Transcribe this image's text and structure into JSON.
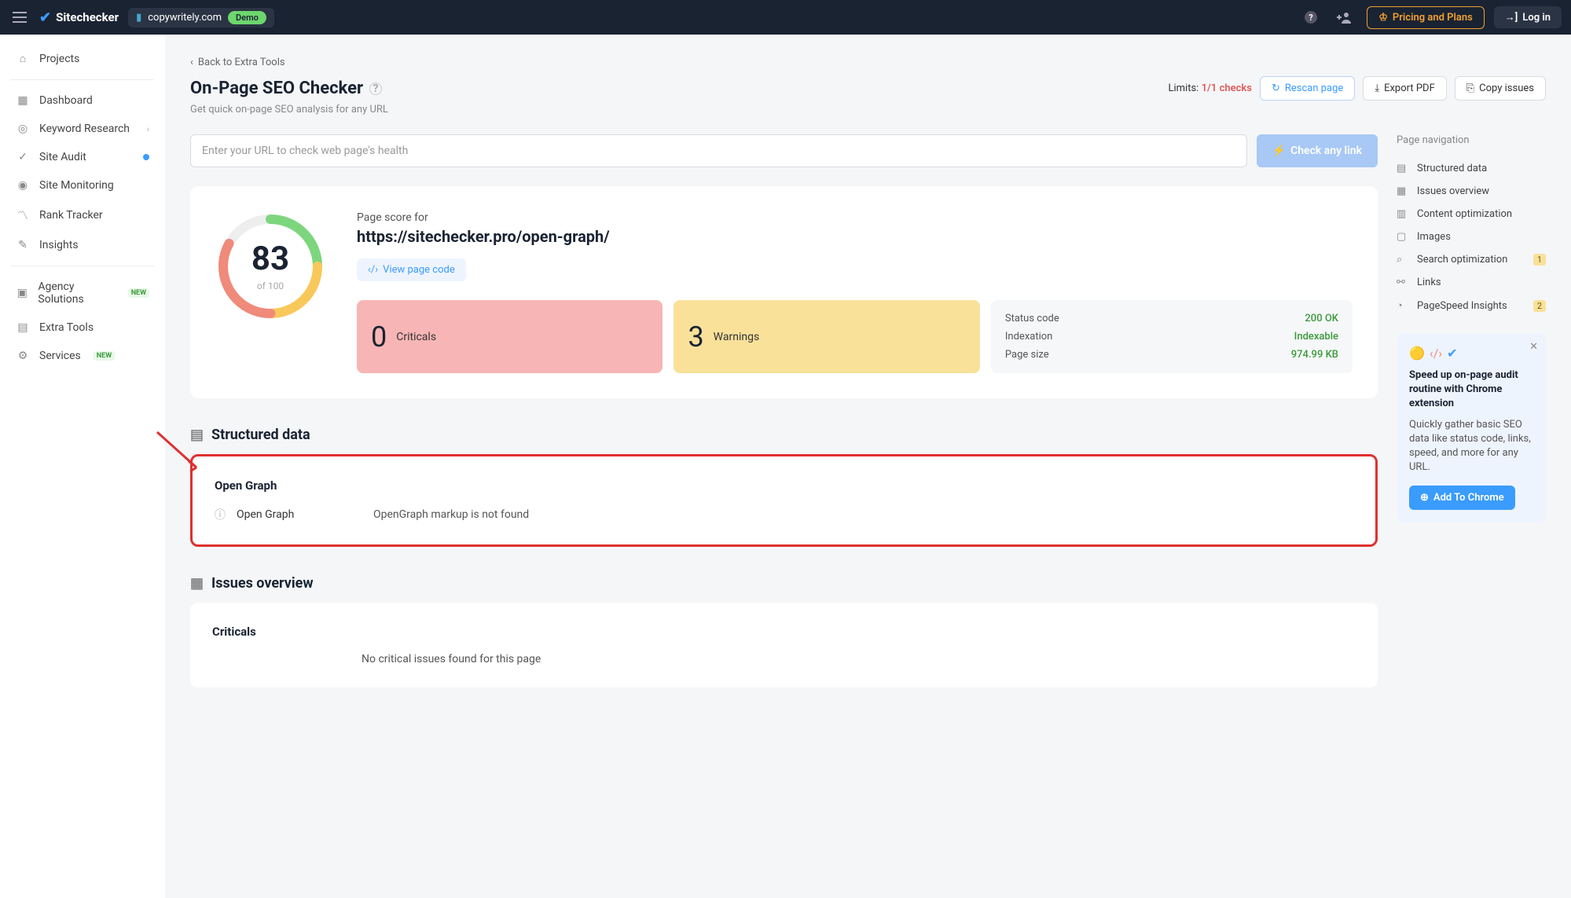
{
  "topbar": {
    "brand": "Sitechecker",
    "site": "copywritely.com",
    "demo": "Demo",
    "pricing": "Pricing and Plans",
    "login": "Log in"
  },
  "sidebar": {
    "projects": "Projects",
    "items": [
      {
        "label": "Dashboard"
      },
      {
        "label": "Keyword Research"
      },
      {
        "label": "Site Audit"
      },
      {
        "label": "Site Monitoring"
      },
      {
        "label": "Rank Tracker"
      },
      {
        "label": "Insights"
      }
    ],
    "agency": "Agency Solutions",
    "extra": "Extra Tools",
    "services": "Services",
    "new": "NEW"
  },
  "breadcrumb": "Back to Extra Tools",
  "page": {
    "title": "On-Page SEO Checker",
    "subtitle": "Get quick on-page SEO analysis for any URL",
    "limits_label": "Limits:",
    "limits_value": "1/1 checks",
    "rescan": "Rescan page",
    "export": "Export PDF",
    "copy": "Copy issues"
  },
  "url": {
    "placeholder": "Enter your URL to check web page's health",
    "check": "Check any link"
  },
  "score": {
    "value": "83",
    "sub": "of 100",
    "for": "Page score for",
    "url": "https://sitechecker.pro/open-graph/",
    "viewcode": "View page code",
    "criticals_n": "0",
    "criticals": "Criticals",
    "warnings_n": "3",
    "warnings": "Warnings",
    "status_label": "Status code",
    "status_val": "200 OK",
    "index_label": "Indexation",
    "index_val": "Indexable",
    "size_label": "Page size",
    "size_val": "974.99 KB"
  },
  "structured": {
    "title": "Structured data",
    "og_title": "Open Graph",
    "og_label": "Open Graph",
    "og_val": "OpenGraph markup is not found"
  },
  "issues": {
    "title": "Issues overview",
    "crit_title": "Criticals",
    "crit_val": "No critical issues found for this page"
  },
  "nav": {
    "title": "Page navigation",
    "items": [
      {
        "label": "Structured data"
      },
      {
        "label": "Issues overview"
      },
      {
        "label": "Content optimization"
      },
      {
        "label": "Images"
      },
      {
        "label": "Search optimization",
        "badge": "1"
      },
      {
        "label": "Links"
      },
      {
        "label": "PageSpeed Insights",
        "badge": "2"
      }
    ]
  },
  "promo": {
    "title": "Speed up on-page audit routine with Chrome extension",
    "text": "Quickly gather basic SEO data like status code, links, speed, and more for any URL.",
    "cta": "Add To Chrome"
  }
}
